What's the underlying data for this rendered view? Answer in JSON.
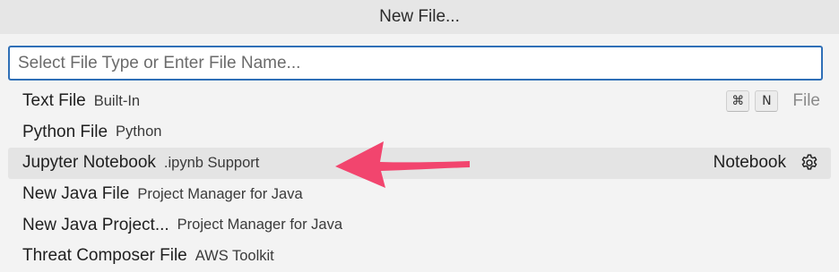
{
  "title": "New File...",
  "search": {
    "placeholder": "Select File Type or Enter File Name...",
    "value": ""
  },
  "items": [
    {
      "label": "Text File",
      "description": "Built-In",
      "keybinding": [
        "⌘",
        "N"
      ],
      "kind": "File"
    },
    {
      "label": "Python File",
      "description": "Python"
    },
    {
      "label": "Jupyter Notebook",
      "description": ".ipynb Support",
      "kind": "Notebook",
      "selected": true
    },
    {
      "label": "New Java File",
      "description": "Project Manager for Java"
    },
    {
      "label": "New Java Project...",
      "description": "Project Manager for Java"
    },
    {
      "label": "Threat Composer File",
      "description": "AWS Toolkit"
    }
  ],
  "icons": {
    "settings": "gear-icon",
    "annotation": "arrow-annotation"
  },
  "colors": {
    "focus_border": "#2f6fb7",
    "selected_row": "#e4e4e4",
    "annotation_arrow": "#f2456e"
  }
}
